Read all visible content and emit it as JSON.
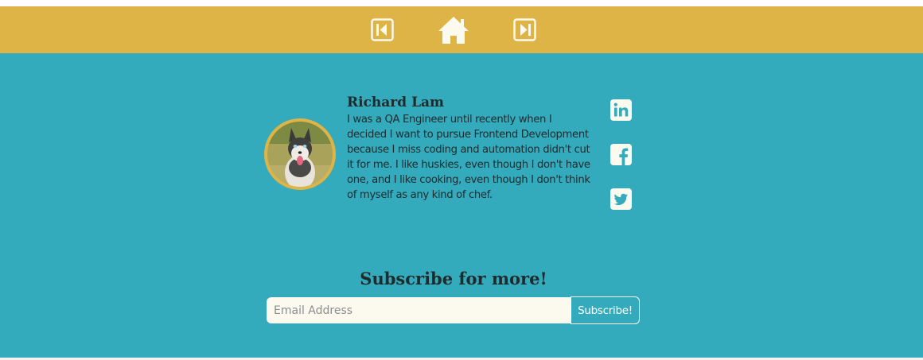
{
  "nav": {
    "icons": [
      "previous-arrow-icon",
      "home-icon",
      "next-arrow-icon"
    ]
  },
  "author": {
    "name": "Richard Lam",
    "bio": "I was a QA Engineer until recently when I decided I want to pursue Frontend Development because I miss coding and automation didn't cut it for me. I like huskies, even though I don't have one, and I like cooking, even though I don't think of myself as any kind of chef.",
    "avatar_icon": "husky-photo"
  },
  "social": [
    "linkedin-icon",
    "facebook-icon",
    "twitter-icon"
  ],
  "subscribe": {
    "title": "Subscribe for more!",
    "placeholder": "Email Address",
    "value": "",
    "button_label": "Subscribe!"
  },
  "colors": {
    "nav_background": "#dfb446",
    "main_background": "#33abbc",
    "input_background": "#fcf9ee",
    "text": "#1f2a2c",
    "icon": "#fcf9ee"
  }
}
